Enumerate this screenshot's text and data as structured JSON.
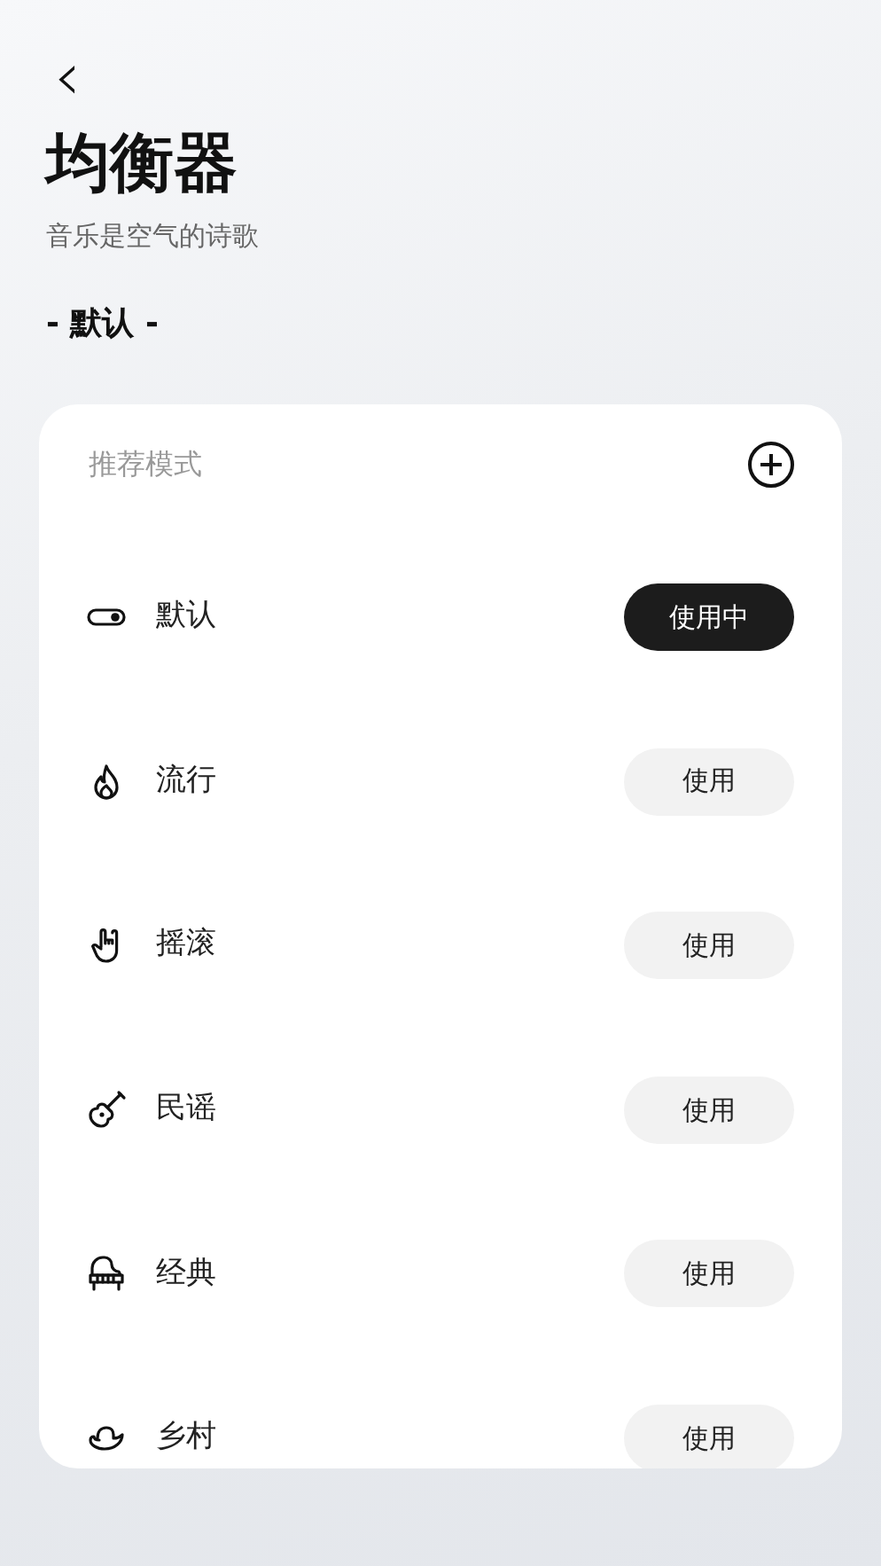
{
  "header": {
    "back": "‹",
    "title": "均衡器",
    "subtitle": "音乐是空气的诗歌",
    "current": "- 默认 -"
  },
  "card": {
    "heading": "推荐模式",
    "modes": [
      {
        "kind": "toggle",
        "label": "默认",
        "button": "使用中",
        "selected": true
      },
      {
        "kind": "flame",
        "label": "流行",
        "button": "使用",
        "selected": false
      },
      {
        "kind": "hand",
        "label": "摇滚",
        "button": "使用",
        "selected": false
      },
      {
        "kind": "guitar",
        "label": "民谣",
        "button": "使用",
        "selected": false
      },
      {
        "kind": "piano",
        "label": "经典",
        "button": "使用",
        "selected": false
      },
      {
        "kind": "hat",
        "label": "乡村",
        "button": "使用",
        "selected": false
      }
    ]
  }
}
